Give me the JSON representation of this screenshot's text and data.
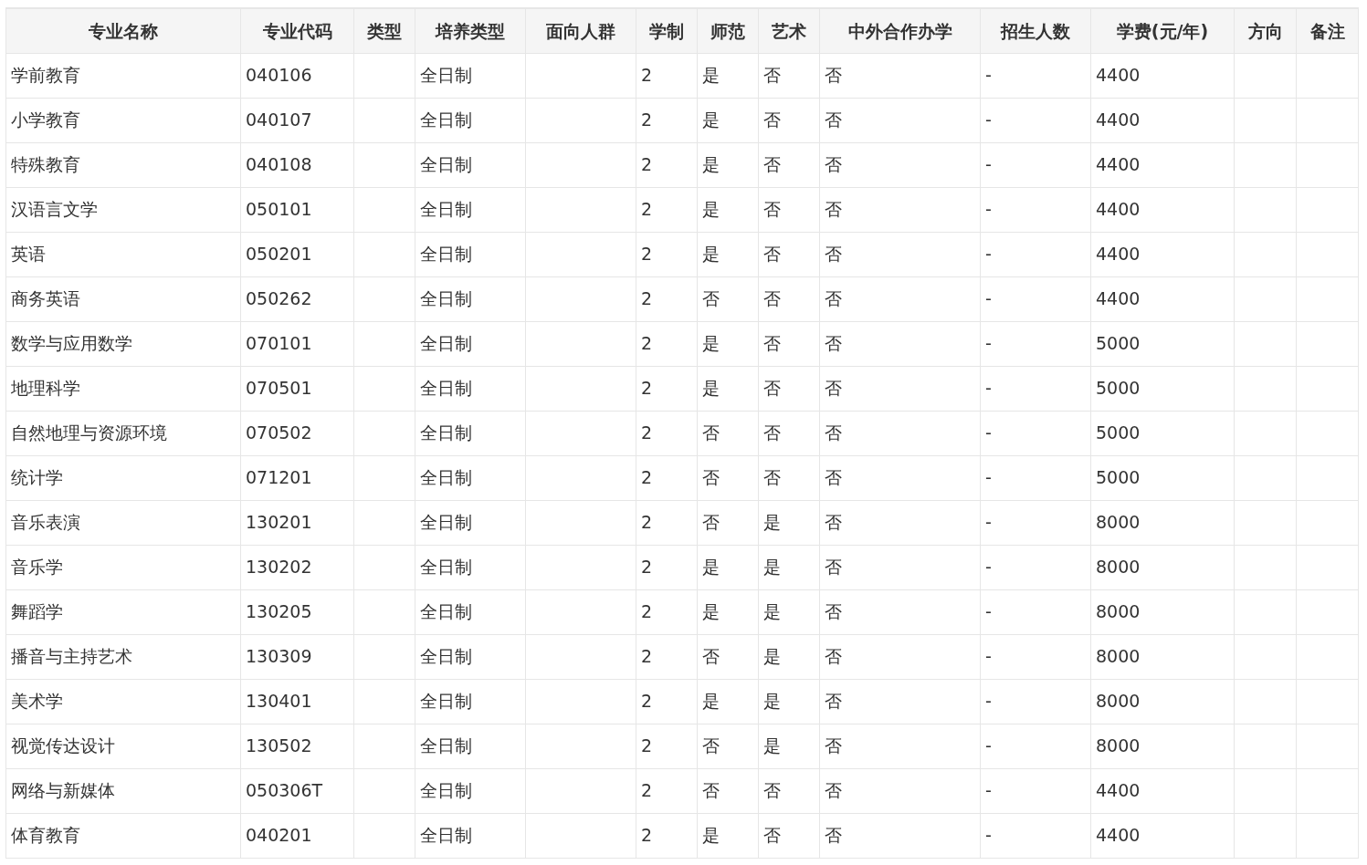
{
  "table": {
    "columns": [
      "专业名称",
      "专业代码",
      "类型",
      "培养类型",
      "面向人群",
      "学制",
      "师范",
      "艺术",
      "中外合作办学",
      "招生人数",
      "学费(元/年)",
      "方向",
      "备注"
    ],
    "rows": [
      {
        "name": "学前教育",
        "code": "040106",
        "training_type": "全日制",
        "duration": "2",
        "teacher_training": "是",
        "art": "否",
        "sino_foreign": "否",
        "enrollment": "-",
        "tuition": "4400"
      },
      {
        "name": "小学教育",
        "code": "040107",
        "training_type": "全日制",
        "duration": "2",
        "teacher_training": "是",
        "art": "否",
        "sino_foreign": "否",
        "enrollment": "-",
        "tuition": "4400"
      },
      {
        "name": "特殊教育",
        "code": "040108",
        "training_type": "全日制",
        "duration": "2",
        "teacher_training": "是",
        "art": "否",
        "sino_foreign": "否",
        "enrollment": "-",
        "tuition": "4400"
      },
      {
        "name": "汉语言文学",
        "code": "050101",
        "training_type": "全日制",
        "duration": "2",
        "teacher_training": "是",
        "art": "否",
        "sino_foreign": "否",
        "enrollment": "-",
        "tuition": "4400"
      },
      {
        "name": "英语",
        "code": "050201",
        "training_type": "全日制",
        "duration": "2",
        "teacher_training": "是",
        "art": "否",
        "sino_foreign": "否",
        "enrollment": "-",
        "tuition": "4400"
      },
      {
        "name": "商务英语",
        "code": "050262",
        "training_type": "全日制",
        "duration": "2",
        "teacher_training": "否",
        "art": "否",
        "sino_foreign": "否",
        "enrollment": "-",
        "tuition": "4400"
      },
      {
        "name": "数学与应用数学",
        "code": "070101",
        "training_type": "全日制",
        "duration": "2",
        "teacher_training": "是",
        "art": "否",
        "sino_foreign": "否",
        "enrollment": "-",
        "tuition": "5000"
      },
      {
        "name": "地理科学",
        "code": "070501",
        "training_type": "全日制",
        "duration": "2",
        "teacher_training": "是",
        "art": "否",
        "sino_foreign": "否",
        "enrollment": "-",
        "tuition": "5000"
      },
      {
        "name": "自然地理与资源环境",
        "code": "070502",
        "training_type": "全日制",
        "duration": "2",
        "teacher_training": "否",
        "art": "否",
        "sino_foreign": "否",
        "enrollment": "-",
        "tuition": "5000"
      },
      {
        "name": "统计学",
        "code": "071201",
        "training_type": "全日制",
        "duration": "2",
        "teacher_training": "否",
        "art": "否",
        "sino_foreign": "否",
        "enrollment": "-",
        "tuition": "5000"
      },
      {
        "name": "音乐表演",
        "code": "130201",
        "training_type": "全日制",
        "duration": "2",
        "teacher_training": "否",
        "art": "是",
        "sino_foreign": "否",
        "enrollment": "-",
        "tuition": "8000"
      },
      {
        "name": "音乐学",
        "code": "130202",
        "training_type": "全日制",
        "duration": "2",
        "teacher_training": "是",
        "art": "是",
        "sino_foreign": "否",
        "enrollment": "-",
        "tuition": "8000"
      },
      {
        "name": "舞蹈学",
        "code": "130205",
        "training_type": "全日制",
        "duration": "2",
        "teacher_training": "是",
        "art": "是",
        "sino_foreign": "否",
        "enrollment": "-",
        "tuition": "8000"
      },
      {
        "name": "播音与主持艺术",
        "code": "130309",
        "training_type": "全日制",
        "duration": "2",
        "teacher_training": "否",
        "art": "是",
        "sino_foreign": "否",
        "enrollment": "-",
        "tuition": "8000"
      },
      {
        "name": "美术学",
        "code": "130401",
        "training_type": "全日制",
        "duration": "2",
        "teacher_training": "是",
        "art": "是",
        "sino_foreign": "否",
        "enrollment": "-",
        "tuition": "8000"
      },
      {
        "name": "视觉传达设计",
        "code": "130502",
        "training_type": "全日制",
        "duration": "2",
        "teacher_training": "否",
        "art": "是",
        "sino_foreign": "否",
        "enrollment": "-",
        "tuition": "8000"
      },
      {
        "name": "网络与新媒体",
        "code": "050306T",
        "training_type": "全日制",
        "duration": "2",
        "teacher_training": "否",
        "art": "否",
        "sino_foreign": "否",
        "enrollment": "-",
        "tuition": "4400"
      },
      {
        "name": "体育教育",
        "code": "040201",
        "training_type": "全日制",
        "duration": "2",
        "teacher_training": "是",
        "art": "否",
        "sino_foreign": "否",
        "enrollment": "-",
        "tuition": "4400"
      }
    ]
  }
}
